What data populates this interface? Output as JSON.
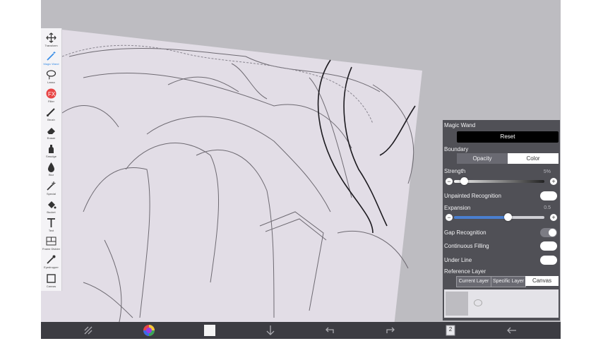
{
  "toolbar": {
    "tools": [
      {
        "label": "Transform",
        "icon": "move-icon"
      },
      {
        "label": "Magic Wand",
        "icon": "magic-wand-icon",
        "active": true
      },
      {
        "label": "Lasso",
        "icon": "lasso-icon"
      },
      {
        "label": "Filter",
        "icon": "fx-icon"
      },
      {
        "label": "Brush",
        "icon": "brush-icon"
      },
      {
        "label": "Eraser",
        "icon": "eraser-icon"
      },
      {
        "label": "Smudge",
        "icon": "smudge-icon"
      },
      {
        "label": "Blur",
        "icon": "blur-icon"
      },
      {
        "label": "Special",
        "icon": "special-icon"
      },
      {
        "label": "Bucket",
        "icon": "bucket-icon"
      },
      {
        "label": "Text",
        "icon": "text-icon"
      },
      {
        "label": "Frame Divider",
        "icon": "frame-divider-icon"
      },
      {
        "label": "Eyedropper",
        "icon": "eyedropper-icon"
      },
      {
        "label": "Canvas",
        "icon": "canvas-icon"
      }
    ],
    "accent_color": "#3a8ee6"
  },
  "panel": {
    "title": "Magic Wand",
    "reset_label": "Reset",
    "boundary_label": "Boundary",
    "boundary_options": [
      "Opacity",
      "Color"
    ],
    "boundary_selected": "Color",
    "strength_label": "Strength",
    "strength_value": "5%",
    "strength_fraction": 0.05,
    "unpainted_label": "Unpainted Recognition",
    "expansion_label": "Expansion",
    "expansion_value": "0.5",
    "expansion_fraction": 0.6,
    "gap_label": "Gap Recognition",
    "gap_on": true,
    "continuous_label": "Continuous Filling",
    "under_line_label": "Under Line",
    "reference_label": "Reference Layer",
    "reference_options": [
      "Current Layer",
      "Specific Layer",
      "Canvas"
    ],
    "reference_selected": "Canvas"
  },
  "bottom_bar": {
    "layer_count": "2",
    "icons": [
      "selection-icon",
      "color-wheel-icon",
      "color-swatch-icon",
      "download-icon",
      "undo-icon",
      "redo-icon",
      "layers-icon",
      "back-icon"
    ]
  }
}
